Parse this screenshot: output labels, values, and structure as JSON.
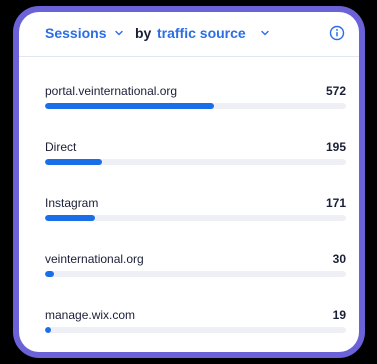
{
  "header": {
    "metric_label": "Sessions",
    "by_label": "by",
    "dimension_label": "traffic source"
  },
  "colors": {
    "accent": "#2b6de6",
    "bar": "#1a6fe8",
    "track": "#eef0f5",
    "frame": "#6b62d8"
  },
  "icons": {
    "metric_dropdown": "chevron-down-icon",
    "dimension_dropdown": "chevron-down-icon",
    "info": "info-icon"
  },
  "rows": [
    {
      "label": "portal.veinternational.org",
      "value": "572",
      "progress": 0.56
    },
    {
      "label": "Direct",
      "value": "195",
      "progress": 0.19
    },
    {
      "label": "Instagram",
      "value": "171",
      "progress": 0.165
    },
    {
      "label": "veinternational.org",
      "value": "30",
      "progress": 0.03
    },
    {
      "label": "manage.wix.com",
      "value": "19",
      "progress": 0.02
    }
  ]
}
